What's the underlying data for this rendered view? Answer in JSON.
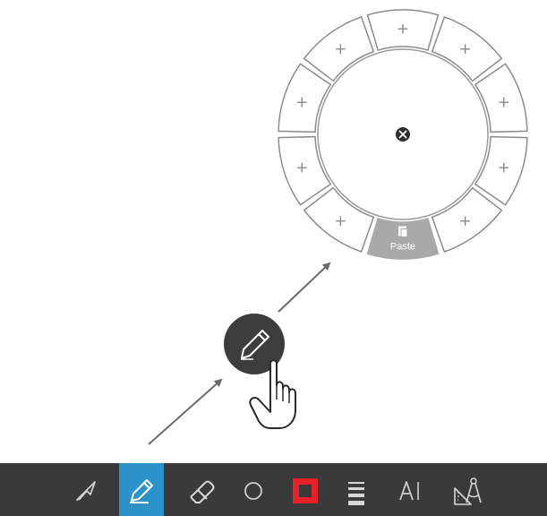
{
  "radial_menu": {
    "slot_label": "+",
    "paste_label": "Paste",
    "close_icon": "close-icon",
    "paste_icon": "paste-icon"
  },
  "floating_button": {
    "icon": "pencil-icon",
    "cursor_icon": "hand-pointer-icon"
  },
  "toolbar": {
    "background": "#3a3a3a",
    "active_color": "#2b93c9",
    "color_swatch": "#e8202a",
    "tools": [
      {
        "icon": "select-arrow-icon"
      },
      {
        "icon": "pen-icon",
        "active": true
      },
      {
        "icon": "eraser-icon"
      },
      {
        "icon": "circle-shape-icon"
      },
      {
        "icon": "color-swatch-icon"
      },
      {
        "icon": "line-width-icon"
      },
      {
        "icon": "text-tool-icon"
      },
      {
        "icon": "geometry-tools-icon"
      }
    ]
  }
}
